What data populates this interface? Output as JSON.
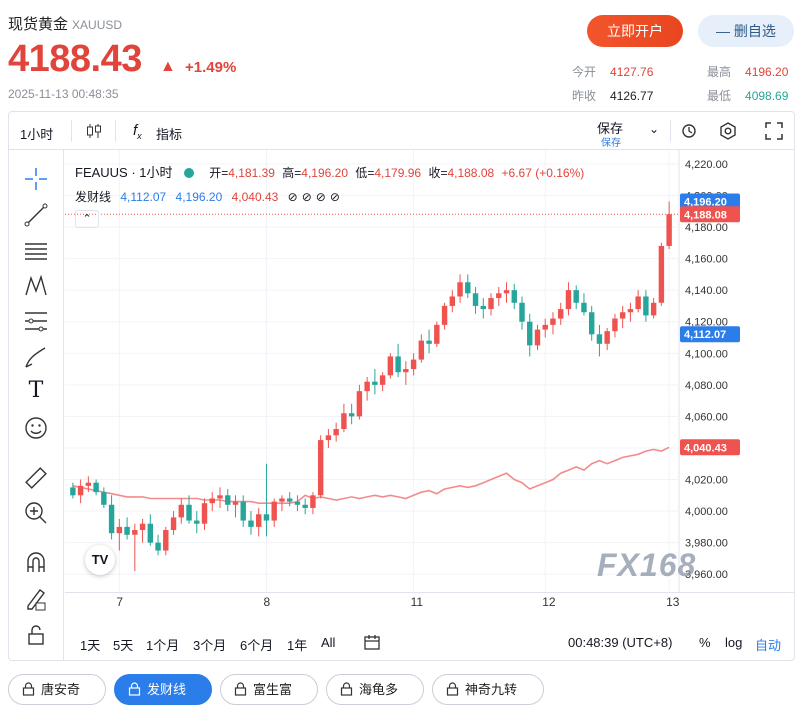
{
  "header": {
    "name": "现货黄金",
    "code": "XAUUSD",
    "price": "4188.43",
    "change": "+1.49%",
    "time": "2025-11-13 00:48:35",
    "open_account_label": "立即开户",
    "watch_label": "— 删自选",
    "stats": {
      "open_label": "今开",
      "open": "4127.76",
      "high_label": "最高",
      "high": "4196.20",
      "prev_label": "昨收",
      "prev": "4126.77",
      "low_label": "最低",
      "low": "4098.69"
    }
  },
  "toolbar": {
    "interval": "1小时",
    "indicator_label": "指标",
    "save_label": "保存",
    "save_sub": "保存"
  },
  "legend": {
    "symbol": "FEAUUS · 1小时",
    "open_label": "开=",
    "open": "4,181.39",
    "high_label": "高=",
    "high": "4,196.20",
    "low_label": "低=",
    "low": "4,179.96",
    "close_label": "收=",
    "close": "4,188.08",
    "chg": "+6.67 (+0.16%)",
    "ind_name": "发财线",
    "ind_v1": "4,112.07",
    "ind_v2": "4,196.20",
    "ind_v3": "4,040.43"
  },
  "price_axis": {
    "ticks": [
      "4,220.00",
      "4,200.00",
      "4,180.00",
      "4,160.00",
      "4,140.00",
      "4,120.00",
      "4,100.00",
      "4,080.00",
      "4,060.00",
      "4,040.00",
      "4,020.00",
      "4,000.00",
      "3,980.00",
      "3,960.00"
    ],
    "tags": {
      "high": "4,196.20",
      "last": "4,188.08",
      "ind_top": "4,112.07",
      "ind_line": "4,040.43"
    }
  },
  "time_axis": {
    "ticks": [
      "7",
      "8",
      "11",
      "12",
      "13"
    ]
  },
  "watermark": "FX168",
  "bottom": {
    "ranges": [
      "1天",
      "5天",
      "1个月",
      "3个月",
      "6个月",
      "1年",
      "All"
    ],
    "clock": "00:48:39 (UTC+8)",
    "pct": "%",
    "log": "log",
    "auto": "自动"
  },
  "indicators": [
    "唐安奇",
    "发财线",
    "富生富",
    "海龟多",
    "神奇九转"
  ],
  "colors": {
    "up": "#ef5350",
    "down": "#26a69a",
    "line": "#f28c8c",
    "accent": "#2b7de9"
  },
  "chart_data": {
    "type": "candlestick",
    "interval": "1小时",
    "ylim": [
      3950,
      4225
    ],
    "candles": [
      [
        4015,
        4018,
        4008,
        4010
      ],
      [
        4010,
        4020,
        4005,
        4016
      ],
      [
        4016,
        4022,
        4012,
        4018
      ],
      [
        4018,
        4020,
        4010,
        4012
      ],
      [
        4012,
        4015,
        4002,
        4004
      ],
      [
        4004,
        4010,
        3982,
        3986
      ],
      [
        3986,
        3995,
        3975,
        3990
      ],
      [
        3990,
        3996,
        3982,
        3985
      ],
      [
        3985,
        3992,
        3962,
        3988
      ],
      [
        3988,
        3995,
        3980,
        3992
      ],
      [
        3992,
        3998,
        3978,
        3980
      ],
      [
        3980,
        3985,
        3972,
        3975
      ],
      [
        3975,
        3990,
        3972,
        3988
      ],
      [
        3988,
        4000,
        3985,
        3996
      ],
      [
        3996,
        4008,
        3992,
        4004
      ],
      [
        4004,
        4010,
        3992,
        3994
      ],
      [
        3994,
        4000,
        3986,
        3992
      ],
      [
        3992,
        4008,
        3988,
        4005
      ],
      [
        4005,
        4012,
        4000,
        4008
      ],
      [
        4008,
        4015,
        4002,
        4010
      ],
      [
        4010,
        4014,
        4000,
        4004
      ],
      [
        4004,
        4010,
        3996,
        4006
      ],
      [
        4006,
        4010,
        3990,
        3994
      ],
      [
        3994,
        4000,
        3985,
        3990
      ],
      [
        3990,
        4002,
        3984,
        3998
      ],
      [
        3998,
        4030,
        3984,
        3994
      ],
      [
        3994,
        4008,
        3990,
        4006
      ],
      [
        4006,
        4010,
        4000,
        4008
      ],
      [
        4008,
        4012,
        4003,
        4006
      ],
      [
        4006,
        4010,
        4000,
        4004
      ],
      [
        4004,
        4008,
        3998,
        4002
      ],
      [
        4002,
        4012,
        3998,
        4010
      ],
      [
        4010,
        4048,
        4008,
        4045
      ],
      [
        4045,
        4052,
        4040,
        4048
      ],
      [
        4048,
        4056,
        4044,
        4052
      ],
      [
        4052,
        4068,
        4050,
        4062
      ],
      [
        4062,
        4068,
        4055,
        4060
      ],
      [
        4060,
        4080,
        4058,
        4076
      ],
      [
        4076,
        4085,
        4070,
        4082
      ],
      [
        4082,
        4090,
        4074,
        4080
      ],
      [
        4080,
        4088,
        4076,
        4086
      ],
      [
        4086,
        4100,
        4084,
        4098
      ],
      [
        4098,
        4106,
        4085,
        4088
      ],
      [
        4088,
        4095,
        4080,
        4090
      ],
      [
        4090,
        4100,
        4086,
        4096
      ],
      [
        4096,
        4112,
        4094,
        4108
      ],
      [
        4108,
        4115,
        4100,
        4106
      ],
      [
        4106,
        4120,
        4104,
        4118
      ],
      [
        4118,
        4132,
        4115,
        4130
      ],
      [
        4130,
        4140,
        4126,
        4136
      ],
      [
        4136,
        4150,
        4132,
        4145
      ],
      [
        4145,
        4150,
        4135,
        4138
      ],
      [
        4138,
        4142,
        4125,
        4130
      ],
      [
        4130,
        4135,
        4122,
        4128
      ],
      [
        4128,
        4138,
        4124,
        4135
      ],
      [
        4135,
        4142,
        4130,
        4138
      ],
      [
        4138,
        4145,
        4132,
        4140
      ],
      [
        4140,
        4144,
        4128,
        4132
      ],
      [
        4132,
        4136,
        4115,
        4120
      ],
      [
        4120,
        4125,
        4098,
        4105
      ],
      [
        4105,
        4118,
        4102,
        4115
      ],
      [
        4115,
        4122,
        4110,
        4118
      ],
      [
        4118,
        4126,
        4112,
        4122
      ],
      [
        4122,
        4132,
        4118,
        4128
      ],
      [
        4128,
        4145,
        4124,
        4140
      ],
      [
        4140,
        4143,
        4128,
        4132
      ],
      [
        4132,
        4138,
        4124,
        4126
      ],
      [
        4126,
        4130,
        4108,
        4112
      ],
      [
        4112,
        4118,
        4098,
        4106
      ],
      [
        4106,
        4116,
        4102,
        4114
      ],
      [
        4114,
        4125,
        4110,
        4122
      ],
      [
        4122,
        4130,
        4116,
        4126
      ],
      [
        4126,
        4132,
        4120,
        4128
      ],
      [
        4128,
        4140,
        4126,
        4136
      ],
      [
        4136,
        4140,
        4120,
        4124
      ],
      [
        4124,
        4135,
        4122,
        4132
      ],
      [
        4132,
        4170,
        4130,
        4168
      ],
      [
        4168,
        4196.2,
        4166,
        4188.08
      ]
    ],
    "indicator_line": [
      4016,
      4015,
      4014,
      4013,
      4012,
      4011,
      4010,
      4009,
      4009,
      4009,
      4008,
      4008,
      4008,
      4008,
      4008,
      4008,
      4008,
      4007,
      4007,
      4007,
      4006,
      4006,
      4006,
      4006,
      4005,
      4005,
      4005,
      4005,
      4005,
      4006,
      4010,
      4008,
      4009,
      4008,
      4007,
      4008,
      4009,
      4008,
      4009,
      4010,
      4009,
      4010,
      4009,
      4008,
      4010,
      4012,
      4013,
      4011,
      4014,
      4015,
      4016,
      4015,
      4016,
      4018,
      4020,
      4022,
      4024,
      4020,
      4018,
      4014,
      4016,
      4018,
      4020,
      4024,
      4026,
      4028,
      4026,
      4030,
      4032,
      4030,
      4032,
      4034,
      4035,
      4036,
      4038,
      4039,
      4038,
      4040.43
    ],
    "x_labels": [
      "7",
      "8",
      "11",
      "12",
      "13"
    ]
  }
}
